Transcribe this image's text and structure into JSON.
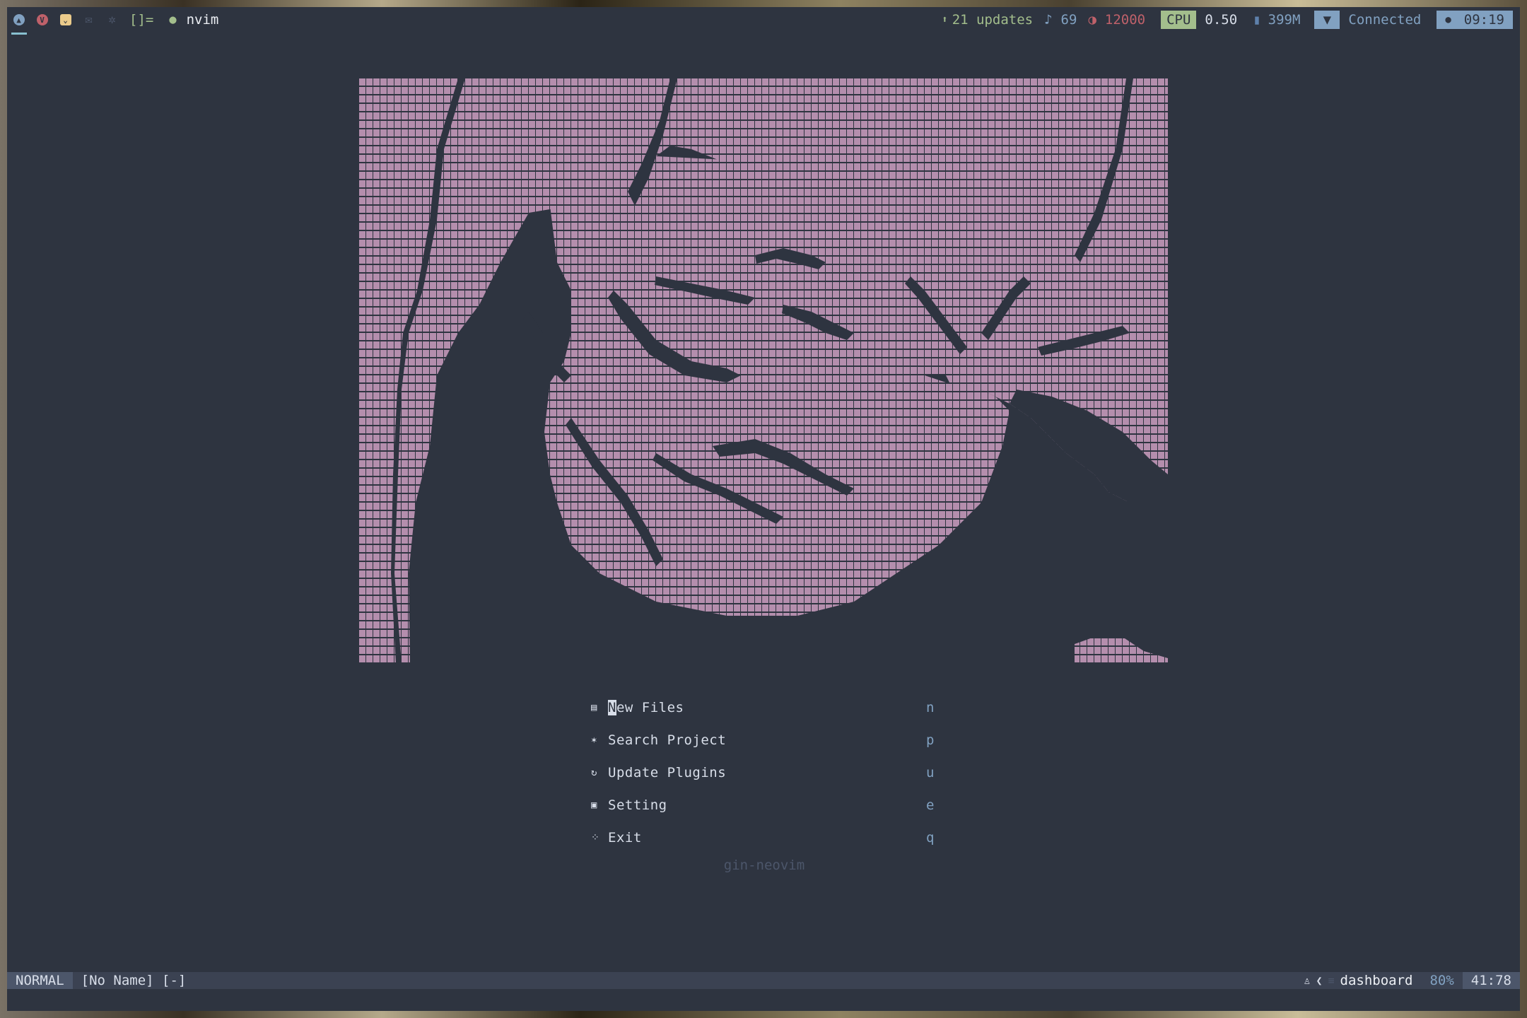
{
  "topbar": {
    "layout_symbol": "[]=",
    "app_title": "nvim",
    "updates": "21 updates",
    "volume": "69",
    "temperature": "12000",
    "cpu_label": "CPU",
    "cpu_load": "0.50",
    "memory": "399M",
    "network_status": "Connected",
    "clock": "09:19",
    "icons": [
      "arch-icon",
      "vivaldi-icon",
      "pocket-icon",
      "mail-icon",
      "settings-icon"
    ]
  },
  "dashboard": {
    "menu": [
      {
        "icon": "file-icon",
        "label_cursor": "N",
        "label_rest": "ew Files",
        "key": "n"
      },
      {
        "icon": "search-icon",
        "label": "Search Project",
        "key": "p"
      },
      {
        "icon": "refresh-icon",
        "label": "Update Plugins",
        "key": "u"
      },
      {
        "icon": "settings-icon",
        "label": "Setting",
        "key": "e"
      },
      {
        "icon": "exit-icon",
        "label": "Exit",
        "key": "q"
      }
    ],
    "footer": "gin-neovim"
  },
  "statusline": {
    "mode": "NORMAL",
    "buffer": "[No Name] [-]",
    "filetype": "dashboard",
    "percent": "80%",
    "position": "41:78"
  },
  "colors": {
    "background": "#2e3440",
    "art": "#b48ead",
    "accent_green": "#a3be8c",
    "accent_blue": "#81a1c1",
    "accent_red": "#bf616a"
  }
}
